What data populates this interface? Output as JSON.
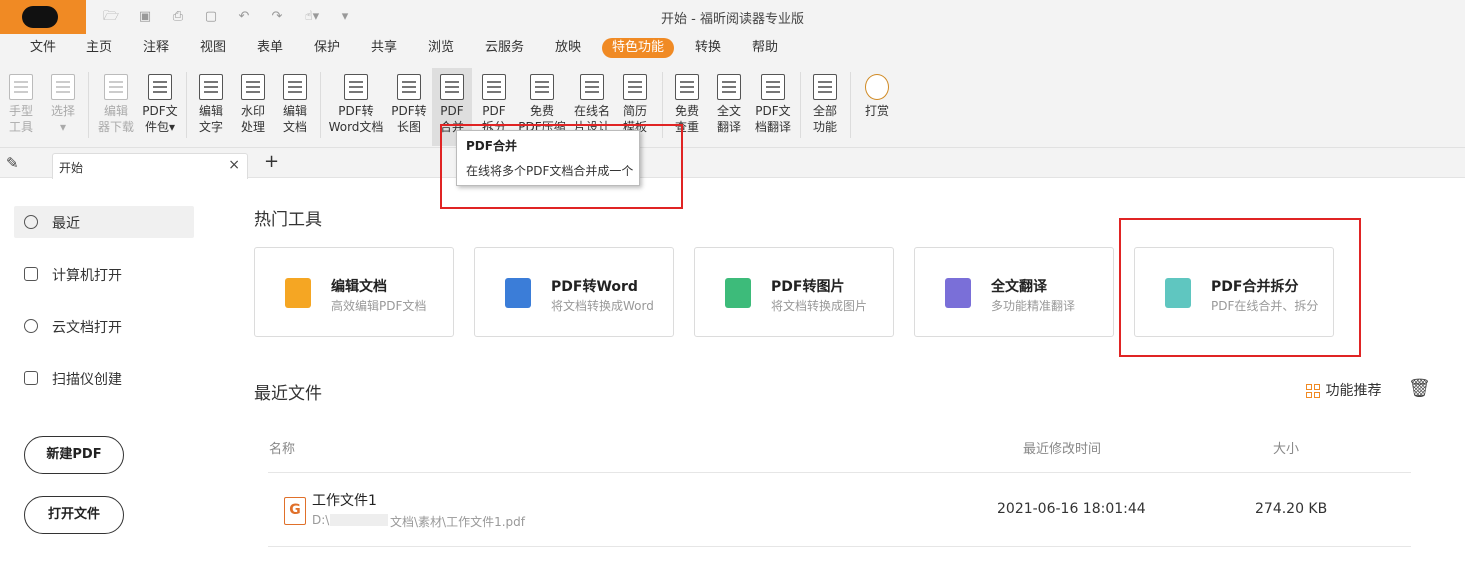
{
  "window": {
    "title": "开始 - 福昕阅读器专业版"
  },
  "menu": [
    "文件",
    "主页",
    "注释",
    "视图",
    "表单",
    "保护",
    "共享",
    "浏览",
    "云服务",
    "放映",
    "特色功能",
    "转换",
    "帮助"
  ],
  "menu_active": "特色功能",
  "ribbon": [
    {
      "label": "手型\n工具",
      "icon": "hand-icon",
      "enabled": false
    },
    {
      "label": "选择\n▾",
      "icon": "select-cursor-icon",
      "enabled": false
    },
    {
      "label": "编辑\n器下载",
      "icon": "editor-download-icon",
      "enabled": false
    },
    {
      "label": "PDF文\n件包▾",
      "icon": "pdf-package-icon",
      "enabled": true
    },
    {
      "label": "编辑\n文字",
      "icon": "edit-text-icon",
      "enabled": true
    },
    {
      "label": "水印\n处理",
      "icon": "watermark-icon",
      "enabled": true
    },
    {
      "label": "编辑\n文档",
      "icon": "edit-document-icon",
      "enabled": true
    },
    {
      "label": "PDF转\nWord文档",
      "icon": "pdf-to-word-icon",
      "enabled": true
    },
    {
      "label": "PDF转\n长图",
      "icon": "pdf-to-image-icon",
      "enabled": true
    },
    {
      "label": "PDF\n合并",
      "icon": "pdf-merge-icon",
      "enabled": true
    },
    {
      "label": "PDF\n拆分",
      "icon": "pdf-split-icon",
      "enabled": true
    },
    {
      "label": "免费\nPDF压缩",
      "icon": "pdf-compress-icon",
      "enabled": true
    },
    {
      "label": "在线名\n片设计",
      "icon": "card-design-icon",
      "enabled": true
    },
    {
      "label": "简历\n模板",
      "icon": "resume-template-icon",
      "enabled": true
    },
    {
      "label": "免费\n查重",
      "icon": "plagiarism-check-icon",
      "enabled": true
    },
    {
      "label": "全文\n翻译",
      "icon": "full-translate-icon",
      "enabled": true
    },
    {
      "label": "PDF文\n档翻译",
      "icon": "pdf-translate-icon",
      "enabled": true
    },
    {
      "label": "全部\n功能",
      "icon": "all-features-icon",
      "enabled": true
    },
    {
      "label": "打赏",
      "icon": "reward-icon",
      "enabled": true
    }
  ],
  "tooltip": {
    "title": "PDF合并",
    "desc": "在线将多个PDF文档合并成一个"
  },
  "tabs": {
    "active": "开始",
    "close": "×",
    "add": "+"
  },
  "sidebar": {
    "items": [
      {
        "label": "最近",
        "icon": "clock-icon"
      },
      {
        "label": "计算机打开",
        "icon": "computer-icon"
      },
      {
        "label": "云文档打开",
        "icon": "cloud-icon"
      },
      {
        "label": "扫描仪创建",
        "icon": "scanner-icon"
      }
    ],
    "new_pdf": "新建PDF",
    "open_file": "打开文件"
  },
  "hot_tools": {
    "title": "热门工具",
    "cards": [
      {
        "title": "编辑文档",
        "desc": "高效编辑PDF文档",
        "icon": "edit-doc-icon",
        "color": "#f5a623"
      },
      {
        "title": "PDF转Word",
        "desc": "将文档转换成Word",
        "icon": "word-icon",
        "color": "#3b7dd8"
      },
      {
        "title": "PDF转图片",
        "desc": "将文档转换成图片",
        "icon": "image-icon",
        "color": "#3dbb7a"
      },
      {
        "title": "全文翻译",
        "desc": "多功能精准翻译",
        "icon": "translate-icon",
        "color": "#7a6fd8"
      },
      {
        "title": "PDF合并拆分",
        "desc": "PDF在线合并、拆分",
        "icon": "merge-split-icon",
        "color": "#5fc6c0"
      }
    ]
  },
  "recent": {
    "title": "最近文件",
    "recommend": "功能推荐",
    "columns": {
      "name": "名称",
      "modified": "最近修改时间",
      "size": "大小"
    },
    "files": [
      {
        "name": "工作文件1",
        "path_start": "D:\\",
        "path_end": "文档\\素材\\工作文件1.pdf",
        "modified": "2021-06-16 18:01:44",
        "size": "274.20 KB"
      }
    ]
  },
  "colors": {
    "accent": "#f08a24",
    "highlight": "#e02424"
  }
}
